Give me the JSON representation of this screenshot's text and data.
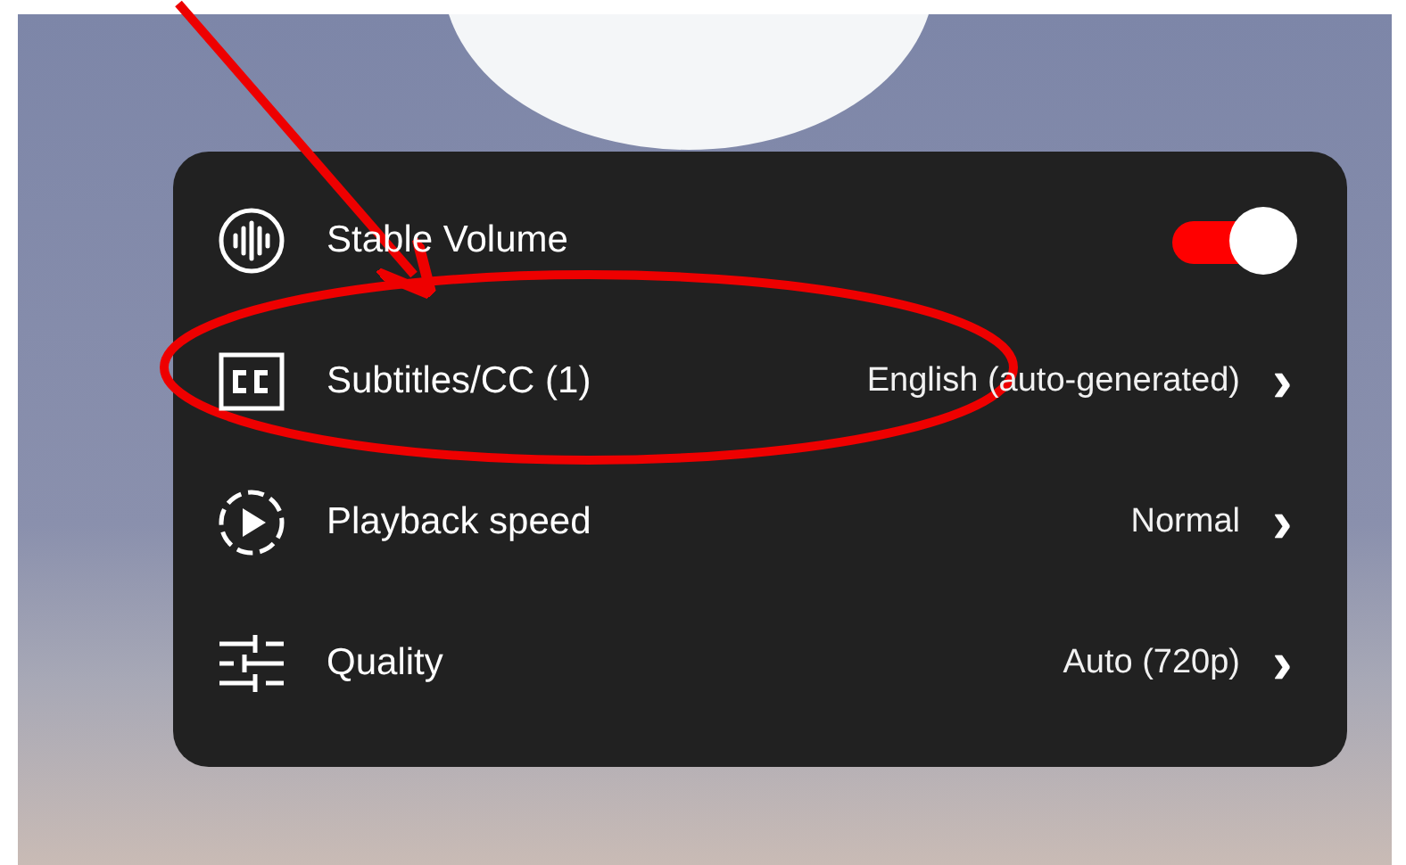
{
  "menu": {
    "items": [
      {
        "kind": "toggle",
        "label": "Stable Volume",
        "on": true
      },
      {
        "kind": "submenu",
        "label": "Subtitles/CC (1)",
        "value": "English (auto-generated)",
        "chevron": "›"
      },
      {
        "kind": "submenu",
        "label": "Playback speed",
        "value": "Normal",
        "chevron": "›"
      },
      {
        "kind": "submenu",
        "label": "Quality",
        "value": "Auto (720p)",
        "chevron": "›"
      }
    ]
  }
}
